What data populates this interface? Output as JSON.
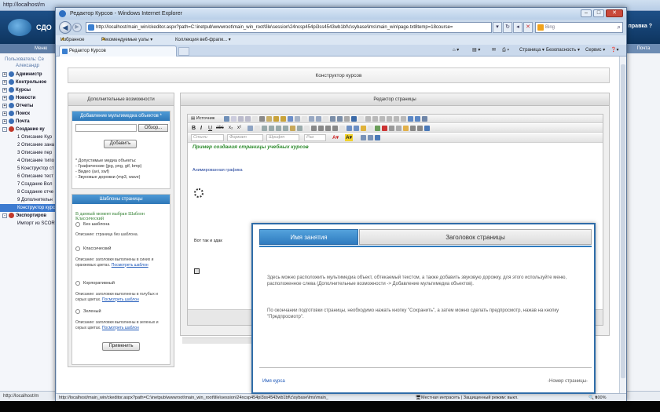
{
  "background": {
    "url": "http://localhost/m",
    "nav_left": "Меню",
    "nav_right": "Почта",
    "right_button": "правка ?",
    "brand": "СДО",
    "user_line1": "Пользователь: Се",
    "user_line2": "Александр",
    "tree": [
      {
        "label": "Администр",
        "toggle": "+",
        "top": true
      },
      {
        "label": "Контрольное",
        "toggle": "+",
        "top": true
      },
      {
        "label": "Курсы",
        "toggle": "+",
        "top": true
      },
      {
        "label": "Новости",
        "toggle": "+",
        "top": true
      },
      {
        "label": "Отчеты",
        "toggle": "+",
        "top": true
      },
      {
        "label": "Поиск",
        "toggle": "+",
        "top": true
      },
      {
        "label": "Почта",
        "toggle": "+",
        "top": true
      },
      {
        "label": "Создание ку",
        "toggle": "-",
        "top": true
      },
      {
        "label": "1 Описание Кур",
        "top": false
      },
      {
        "label": "2 Описание зана",
        "top": false
      },
      {
        "label": "3 Описание пер",
        "top": false
      },
      {
        "label": "4 Описание типо",
        "top": false
      },
      {
        "label": "5 Конструктор ст",
        "top": false
      },
      {
        "label": "6 Описание тест",
        "top": false
      },
      {
        "label": "7 Создание Вол",
        "top": false
      },
      {
        "label": "8 Создание отче",
        "top": false
      },
      {
        "label": "9 Дополнительн",
        "top": false
      },
      {
        "label": "Конструктор курс",
        "top": false,
        "selected": true
      },
      {
        "label": "Экспортиров",
        "toggle": "-",
        "top": true
      },
      {
        "label": "Импорт из SCOR",
        "top": false
      }
    ],
    "status": "http://localhost/m"
  },
  "ie": {
    "title": "Редактор Курсов - Windows Internet Explorer",
    "address": "http://localhost/main_win/ckeditor.aspx?path=C:\\inetpub\\wwwroot\\main_win_root\\file\\session\\24ncsp454pi3ss4543wb1bf\\c\\sybase\\lms\\main_win\\page.txt8temp=18course=",
    "search_placeholder": "Bing",
    "favorites": "Избранное",
    "recommended": "Рекомендуемые узлы ▾",
    "collection": "Коллекция веб-фрагм... ▾",
    "tab": "Редактор Курсов",
    "cmd_page": "Страница ▾",
    "cmd_security": "Безопасность ▾",
    "cmd_service": "Сервис ▾",
    "status_url": "http://localhost/main_win/ckeditor.aspx?path=C:\\inetpub\\wwwroot\\main_win_root\\file\\session\\24ncsp454pi3ss4543wb1bf\\c\\sybase\\lms\\main_",
    "status_zone": "Местная интрасеть | Защищенный режим: выкл.",
    "zoom": "100%"
  },
  "page": {
    "header": "Конструктор курсов",
    "left_title": "Дополнительные возможности",
    "media_title": "Добавление мультимедиа объектов *",
    "browse": "Обзор...",
    "add": "Добавить",
    "media_note": "* Допустимые медиа объекты:\n- Графические (jpg, png, gif, bmp)\n- Видео (avi, swf)\n- Звуковые дорожки (mp3, wave)",
    "templates_title": "Шаблоны страницы",
    "current_template": "В данный момент выбран Шаблон Классический",
    "templates": [
      {
        "name": "Без шаблона",
        "desc": "Описание: страница без шаблона.",
        "link": ""
      },
      {
        "name": "Классический",
        "desc": "Описание: заголовки выполнены в синих и оранжевых цветах.",
        "link": "Посмотреть шаблон"
      },
      {
        "name": "Корпоративный",
        "desc": "Описание: заголовки выполнены в голубых и серых цветах.",
        "link": "Посмотреть шаблон"
      },
      {
        "name": "Зеленый",
        "desc": "Описание: заголовки выполнены в зеленых и серых цветах.",
        "link": "Посмотреть шаблон"
      }
    ],
    "apply": "Применить",
    "editor_title": "Редактор страницы",
    "source": "Источник",
    "style": "Стили",
    "format": "Формат",
    "font": "Шрифт",
    "size": "Раз",
    "content_title": "Пример создания страницы учебных курсов",
    "content_sub": "Анимированная графика",
    "content_text": "Вот так и здак"
  },
  "modal": {
    "tab_active": "Имя занятия",
    "tab_inactive": "Заголовок страницы",
    "text1": "Здесь можно расположить мультимедиа объект, обтекаемый текстом, а также добавить звуковую дорожку, для этого используйте меню, расположенное слева (Дополнительные возможности -> Добавление мультимедиа объектов).",
    "text2": "По окончании подготовки страницы, необходимо нажать кнопку \"Сохранить\", а затем можно сделать предпросмотр, нажав на кнопку \"Предпросмотр\".",
    "footer_left": "Имя курса",
    "footer_right": "-Номер страницы-"
  },
  "colors": {
    "accent": "#2e7bbf",
    "header": "#1d4f87",
    "green_title": "#2b8a2b"
  }
}
